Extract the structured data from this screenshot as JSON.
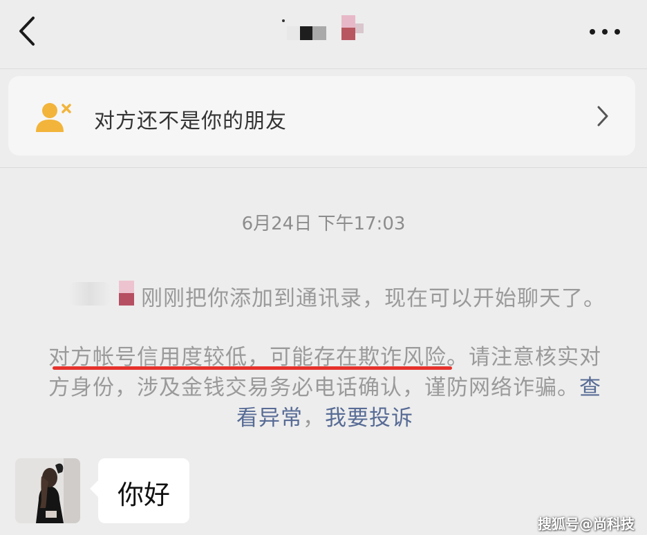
{
  "header": {
    "back_icon": "chevron-left-icon",
    "more_icon": "more-dots-icon"
  },
  "banner": {
    "icon": "user-remove-icon",
    "text": "对方还不是你的朋友",
    "chevron_icon": "chevron-right-icon",
    "colors": {
      "icon": "#f2b43a",
      "icon_x": "#f2b43a"
    }
  },
  "chat": {
    "timestamp": "6月24日 下午17:03",
    "system_message": "刚刚把你添加到通讯录，现在可以开始聊天了。",
    "warning": {
      "line1_risk": "对方帐号信用度较低，可能存在欺诈风险。",
      "line1_rest": "请注意核实对",
      "line2_text": "方身份，涉及金钱交易务必电话确认，谨防网络诈骗。",
      "line2_link": "查",
      "line3_link_a": "看异常",
      "line3_sep": "，",
      "line3_link_b": "我要投诉"
    },
    "messages": [
      {
        "text": "你好"
      }
    ]
  },
  "watermark": "搜狐号@尚科技",
  "colors": {
    "background": "#ededed",
    "link": "#576b95",
    "underline": "#e5312b",
    "bubble": "#ffffff"
  }
}
